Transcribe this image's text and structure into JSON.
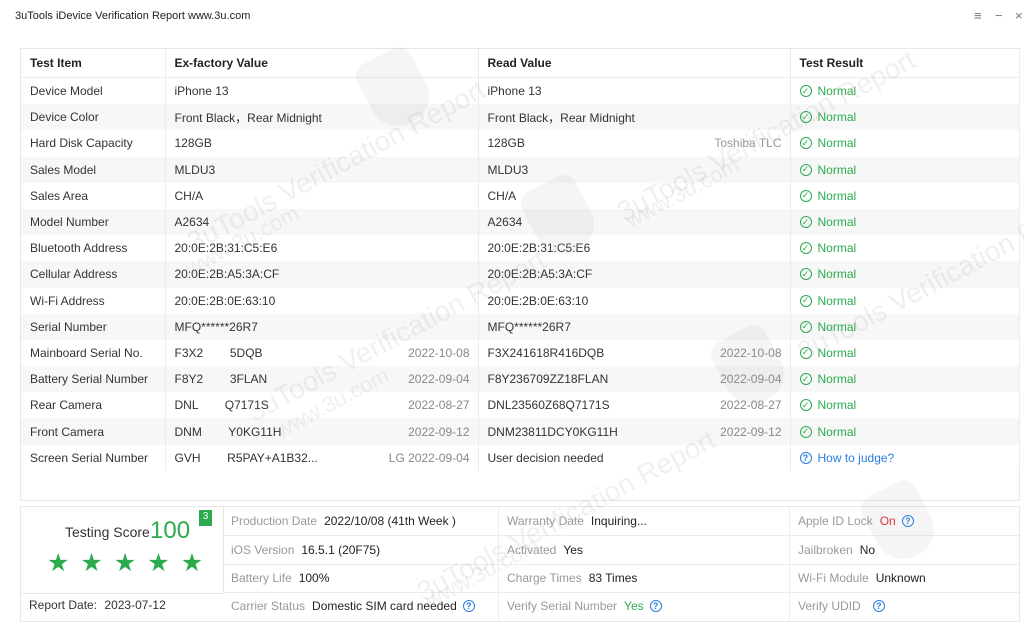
{
  "window": {
    "title": "3uTools iDevice Verification Report www.3u.com",
    "menu_icon": "menu-icon",
    "min_icon": "minimize-icon",
    "close_icon": "close-icon"
  },
  "table": {
    "headers": [
      "Test Item",
      "Ex-factory Value",
      "Read Value",
      "Test Result"
    ],
    "rows": [
      {
        "item": "Device Model",
        "factory": "iPhone 13",
        "factory_date": "",
        "read": "iPhone 13",
        "read_extra": "",
        "result": "Normal",
        "result_type": "normal"
      },
      {
        "item": "Device Color",
        "factory": "Front Black，Rear Midnight",
        "factory_date": "",
        "read": "Front Black，Rear Midnight",
        "read_extra": "",
        "result": "Normal",
        "result_type": "normal"
      },
      {
        "item": "Hard Disk Capacity",
        "factory": "128GB",
        "factory_date": "",
        "read": "128GB",
        "read_extra": "Toshiba TLC",
        "result": "Normal",
        "result_type": "normal"
      },
      {
        "item": "Sales Model",
        "factory": "MLDU3",
        "factory_date": "",
        "read": "MLDU3",
        "read_extra": "",
        "result": "Normal",
        "result_type": "normal"
      },
      {
        "item": "Sales Area",
        "factory": "CH/A",
        "factory_date": "",
        "read": "CH/A",
        "read_extra": "",
        "result": "Normal",
        "result_type": "normal"
      },
      {
        "item": "Model Number",
        "factory": "A2634",
        "factory_date": "",
        "read": "A2634",
        "read_extra": "",
        "result": "Normal",
        "result_type": "normal"
      },
      {
        "item": "Bluetooth Address",
        "factory": "20:0E:2B:31:C5:E6",
        "factory_date": "",
        "read": "20:0E:2B:31:C5:E6",
        "read_extra": "",
        "result": "Normal",
        "result_type": "normal"
      },
      {
        "item": "Cellular Address",
        "factory": "20:0E:2B:A5:3A:CF",
        "factory_date": "",
        "read": "20:0E:2B:A5:3A:CF",
        "read_extra": "",
        "result": "Normal",
        "result_type": "normal"
      },
      {
        "item": "Wi-Fi Address",
        "factory": "20:0E:2B:0E:63:10",
        "factory_date": "",
        "read": "20:0E:2B:0E:63:10",
        "read_extra": "",
        "result": "Normal",
        "result_type": "normal"
      },
      {
        "item": "Serial Number",
        "factory": "MFQ******26R7",
        "factory_date": "",
        "read": "MFQ******26R7",
        "read_extra": "",
        "result": "Normal",
        "result_type": "normal"
      },
      {
        "item": "Mainboard Serial No.",
        "factory": "F3X2        5DQB",
        "factory_date": "2022-10-08",
        "read": "F3X241618R416DQB",
        "read_extra": "2022-10-08",
        "result": "Normal",
        "result_type": "normal"
      },
      {
        "item": "Battery Serial Number",
        "factory": "F8Y2        3FLAN",
        "factory_date": "2022-09-04",
        "read": "F8Y236709ZZ18FLAN",
        "read_extra": "2022-09-04",
        "result": "Normal",
        "result_type": "normal"
      },
      {
        "item": "Rear Camera",
        "factory": "DNL        Q7171S",
        "factory_date": "2022-08-27",
        "read": "DNL23560Z68Q7171S",
        "read_extra": "2022-08-27",
        "result": "Normal",
        "result_type": "normal"
      },
      {
        "item": "Front Camera",
        "factory": "DNM        Y0KG11H",
        "factory_date": "2022-09-12",
        "read": "DNM23811DCY0KG11H",
        "read_extra": "2022-09-12",
        "result": "Normal",
        "result_type": "normal"
      },
      {
        "item": "Screen Serial Number",
        "factory": "GVH        R5PAY+A1B32...",
        "factory_date": "LG 2022-09-04",
        "read": "User decision needed",
        "read_extra": "",
        "result": "How to judge?",
        "result_type": "link"
      }
    ]
  },
  "score": {
    "label": "Testing Score",
    "value": "100",
    "badge": "3",
    "stars": 5,
    "report_date_label": "Report Date:",
    "report_date": "2023-07-12"
  },
  "details": {
    "production_date": {
      "label": "Production Date",
      "value": "2022/10/08 (41th Week )"
    },
    "warranty_date": {
      "label": "Warranty Date",
      "value": "Inquiring..."
    },
    "apple_id_lock": {
      "label": "Apple ID Lock",
      "value": "On"
    },
    "ios_version": {
      "label": "iOS Version",
      "value": "16.5.1 (20F75)"
    },
    "activated": {
      "label": "Activated",
      "value": "Yes"
    },
    "jailbroken": {
      "label": "Jailbroken",
      "value": "No"
    },
    "battery_life": {
      "label": "Battery Life",
      "value": "100%"
    },
    "charge_times": {
      "label": "Charge Times",
      "value": "83 Times"
    },
    "wifi_module": {
      "label": "Wi-Fi Module",
      "value": "Unknown"
    },
    "carrier_status": {
      "label": "Carrier Status",
      "value": "Domestic SIM card needed"
    },
    "verify_serial": {
      "label": "Verify Serial Number",
      "value": "Yes"
    },
    "verify_udid": {
      "label": "Verify UDID",
      "value": ""
    }
  },
  "watermark": {
    "text": "3uTools Verification Report",
    "url": "www.3u.com"
  },
  "colors": {
    "accent_green": "#2bab4e",
    "link_blue": "#2a7de1",
    "red": "#e02c2c"
  }
}
